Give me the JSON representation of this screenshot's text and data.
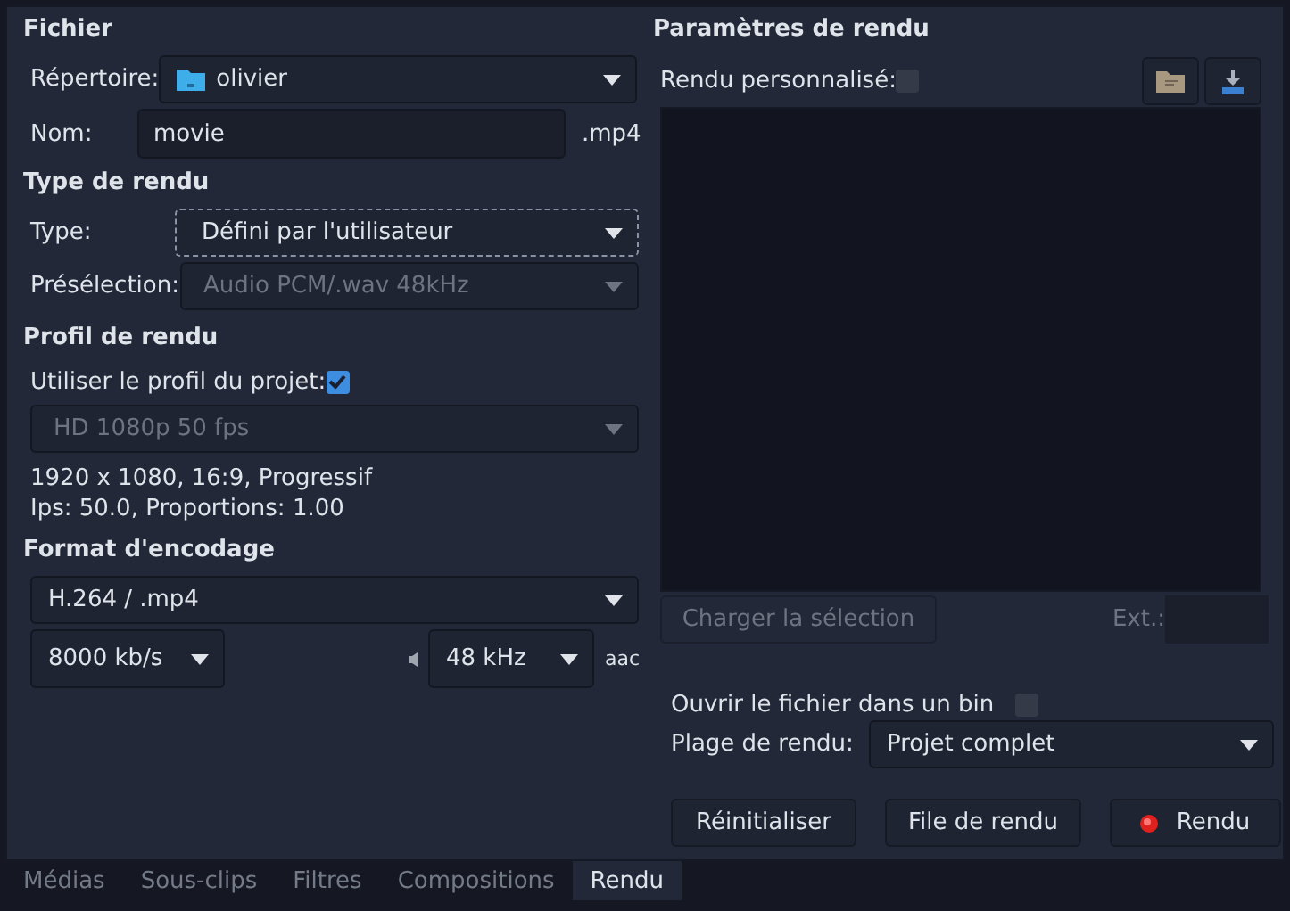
{
  "file": {
    "title": "Fichier",
    "directory_label": "Répertoire:",
    "directory": "olivier",
    "name_label": "Nom:",
    "name": "movie",
    "extension": ".mp4"
  },
  "render_type": {
    "title": "Type de rendu",
    "type_label": "Type:",
    "type": "Défini par l'utilisateur",
    "preset_label": "Présélection:",
    "preset": "Audio PCM/.wav 48kHz",
    "preset_disabled": true
  },
  "profile": {
    "title": "Profil de rendu",
    "use_project_label": "Utiliser le profil du projet:",
    "use_project": true,
    "profile": "HD 1080p 50 fps",
    "profile_disabled": true,
    "info": [
      "1920 x 1080, 16:9, Progressif",
      "Ips: 50.0, Proportions: 1.00"
    ]
  },
  "encoding": {
    "title": "Format d'encodage",
    "format": "H.264 / .mp4",
    "video_bitrate": "8000 kb/s",
    "audio_rate": "48 kHz",
    "audio_codec": "aac"
  },
  "params": {
    "title": "Paramètres de rendu",
    "custom_label": "Rendu personnalisé:",
    "custom": false,
    "load_button": "Charger la sélection",
    "load_disabled": true,
    "ext_label": "Ext.:",
    "open_in_bin_label": "Ouvrir le fichier dans un bin",
    "open_in_bin": false,
    "range_label": "Plage de rendu:",
    "range": "Projet complet",
    "buttons": [
      {
        "label": "Réinitialiser",
        "kind": "plain"
      },
      {
        "label": "File de rendu",
        "kind": "plain"
      },
      {
        "label": "Rendu",
        "kind": "record"
      }
    ]
  },
  "tabs": [
    {
      "label": "Médias",
      "selected": false
    },
    {
      "label": "Sous-clips",
      "selected": false
    },
    {
      "label": "Filtres",
      "selected": false
    },
    {
      "label": "Compositions",
      "selected": false
    },
    {
      "label": "Rendu",
      "selected": true
    }
  ]
}
